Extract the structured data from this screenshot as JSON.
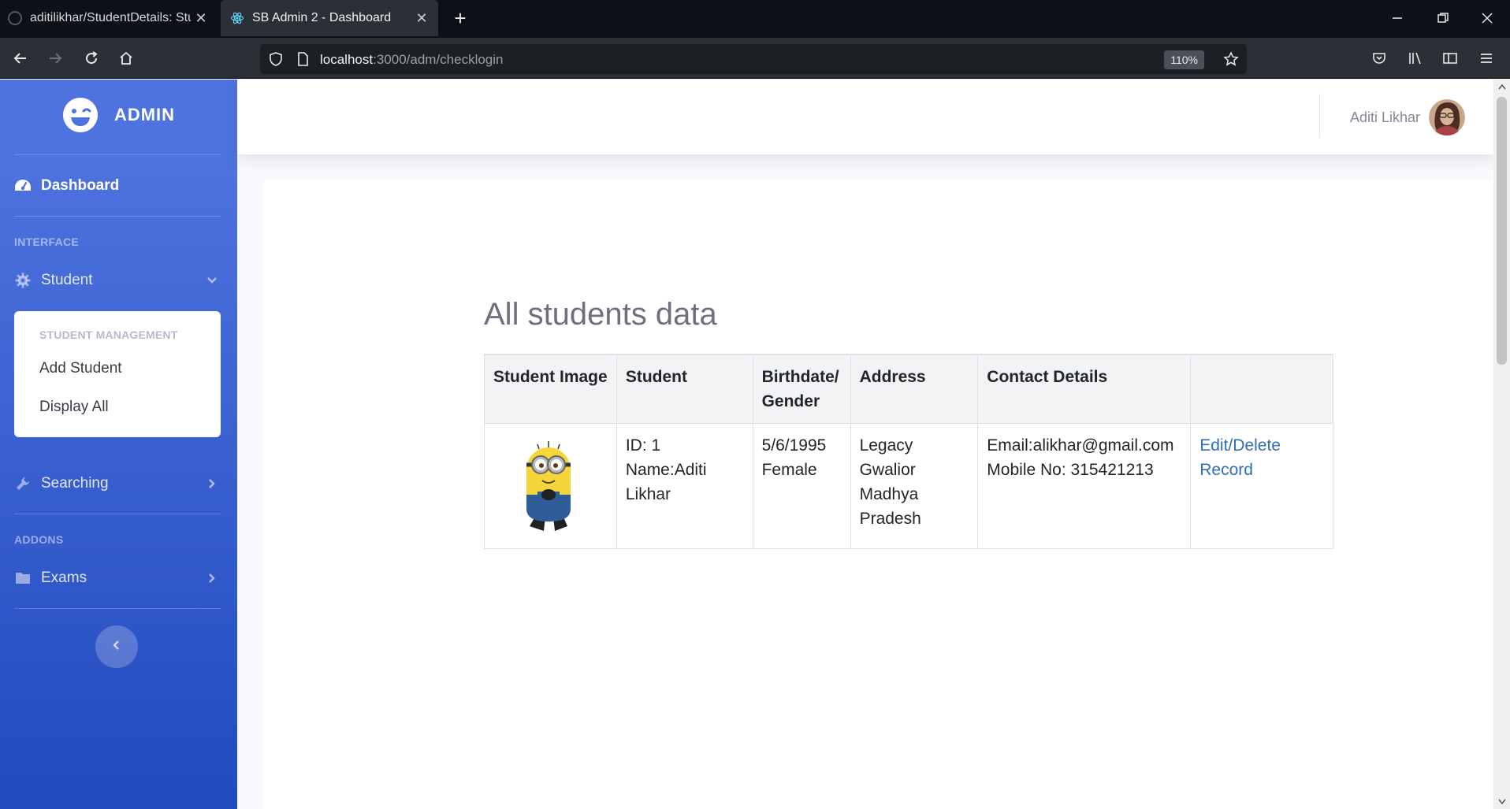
{
  "browser": {
    "tabs": [
      {
        "title": "aditilikhar/StudentDetails: Stude",
        "close": "✕"
      },
      {
        "title": "SB Admin 2 - Dashboard",
        "close": "✕"
      }
    ],
    "new_tab": "+",
    "url_host": "localhost",
    "url_rest": ":3000/adm/checklogin",
    "zoom": "110%"
  },
  "sidebar": {
    "brand": "ADMIN",
    "dashboard": "Dashboard",
    "heading_interface": "INTERFACE",
    "student": "Student",
    "student_menu": {
      "header": "STUDENT MANAGEMENT",
      "items": [
        "Add Student",
        "Display All"
      ]
    },
    "searching": "Searching",
    "heading_addons": "ADDONS",
    "exams": "Exams"
  },
  "topbar": {
    "user_name": "Aditi Likhar"
  },
  "main": {
    "title": "All students data",
    "table": {
      "headers": [
        "Student Image",
        "Student",
        "Birthdate/ Gender",
        "Address",
        "Contact Details",
        ""
      ],
      "rows": [
        {
          "id": "ID: 1",
          "name": "Name:Aditi Likhar",
          "birthdate": "5/6/1995",
          "gender": "Female",
          "address": "Legacy Gwalior Madhya Pradesh",
          "email": "Email:alikhar@gmail.com",
          "mobile": "Mobile No: 315421213",
          "action": "Edit/Delete Record"
        }
      ]
    }
  },
  "colors": {
    "sidebar_top": "#4e73df",
    "sidebar_bottom": "#224abe",
    "link": "#2f6eb5"
  }
}
